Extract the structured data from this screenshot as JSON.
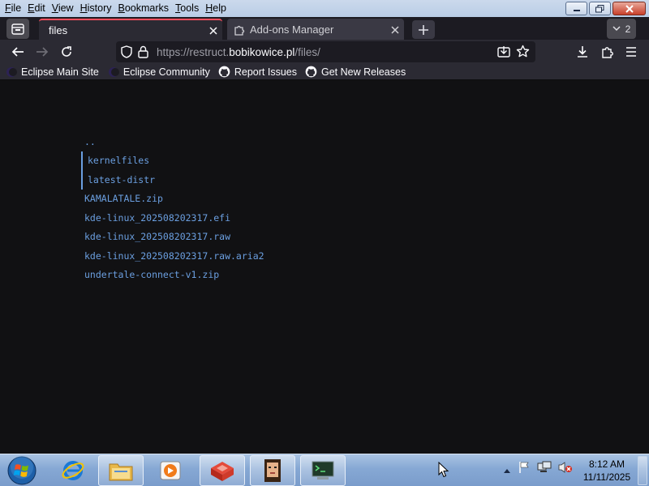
{
  "menubar": {
    "items": [
      {
        "acc": "F",
        "rest": "ile"
      },
      {
        "acc": "E",
        "rest": "dit"
      },
      {
        "acc": "V",
        "rest": "iew"
      },
      {
        "acc": "H",
        "rest": "istory"
      },
      {
        "acc": "B",
        "rest": "ookmarks"
      },
      {
        "acc": "T",
        "rest": "ools"
      },
      {
        "acc": "H",
        "rest": "elp"
      }
    ]
  },
  "tabs": {
    "active": {
      "title": "files"
    },
    "inactive": {
      "title": "Add-ons Manager"
    },
    "count": "2"
  },
  "urlbar": {
    "prefix": "https://restruct.",
    "host": "bobikowice.pl",
    "path": "/files/"
  },
  "bookmarks": [
    {
      "label": "Eclipse Main Site",
      "icon": "eclipse-icon"
    },
    {
      "label": "Eclipse Community",
      "icon": "eclipse-icon"
    },
    {
      "label": "Report Issues",
      "icon": "github-icon"
    },
    {
      "label": "Get New Releases",
      "icon": "github-icon"
    }
  ],
  "files": [
    {
      "name": "..",
      "kind": "parent"
    },
    {
      "name": "kernelfiles",
      "kind": "dir"
    },
    {
      "name": "latest-distr",
      "kind": "dir"
    },
    {
      "name": "KAMALATALE.zip",
      "kind": "file"
    },
    {
      "name": "kde-linux_202508202317.efi",
      "kind": "file"
    },
    {
      "name": "kde-linux_202508202317.raw",
      "kind": "file"
    },
    {
      "name": "kde-linux_202508202317.raw.aria2",
      "kind": "file"
    },
    {
      "name": "undertale-connect-v1.zip",
      "kind": "file"
    }
  ],
  "taskbar": {
    "clock": {
      "time": "8:12 AM",
      "date": "11/11/2025"
    }
  },
  "colors": {
    "link": "#6b9fe0",
    "accent_tab": "#ff4f5e",
    "toolbar": "#2b2a33",
    "content_bg": "#111113"
  }
}
